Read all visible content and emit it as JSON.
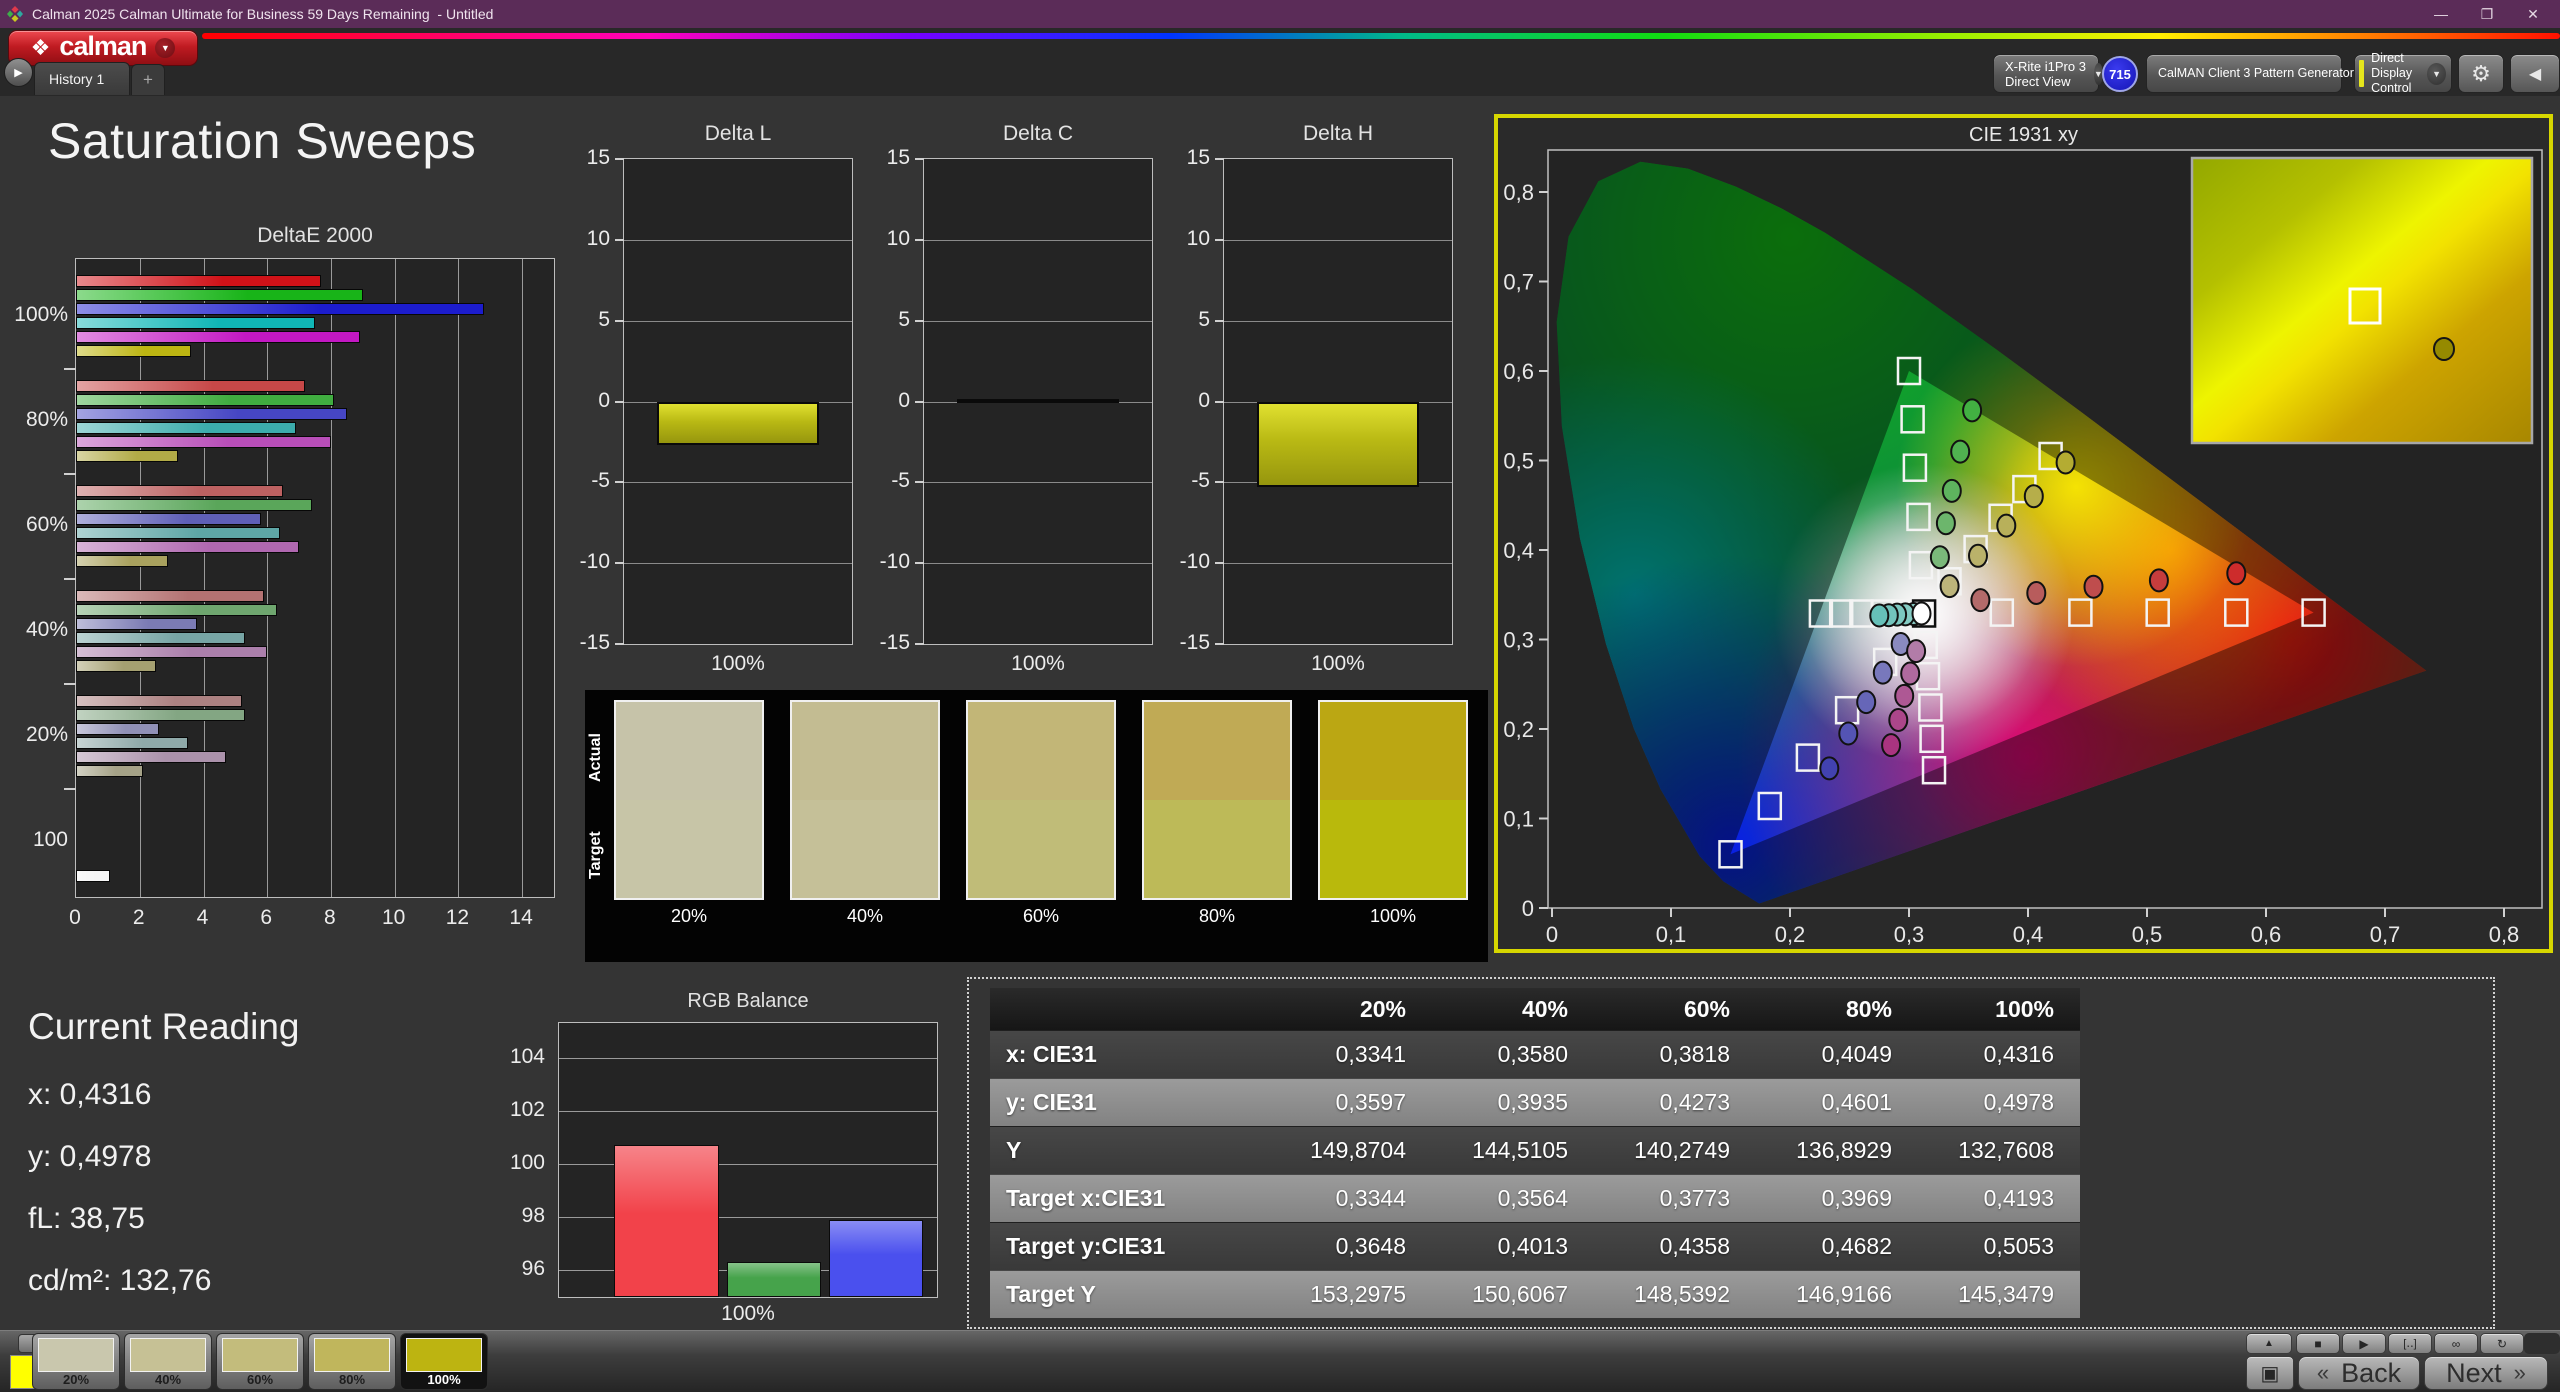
{
  "window": {
    "title": "Calman 2025 Calman Ultimate for Business 59 Days Remaining  - Untitled",
    "minimize": "—",
    "restore": "❐",
    "close": "✕"
  },
  "app": {
    "logo_label": "calman",
    "logo_glyph": "❖",
    "tab_history": "History 1",
    "tab_add": "+",
    "meter": {
      "line1": "X-Rite i1Pro 3",
      "line2": "Direct View",
      "badge": "715",
      "accent": "#3fd43f"
    },
    "source": {
      "label": "CalMAN Client 3 Pattern Generator",
      "accent": "#3fd43f"
    },
    "display_control": {
      "label": "Direct Display Control",
      "accent": "#e6e61c"
    },
    "gear_glyph": "⚙",
    "collapse_glyph": "◀",
    "expander_glyph": "▶",
    "chevron_glyph": "▼"
  },
  "page": {
    "title": "Saturation Sweeps"
  },
  "chart_data": [
    {
      "name": "deltae2000",
      "type": "bar",
      "orientation": "horizontal",
      "title": "DeltaE 2000",
      "x_ticks": [
        0,
        2,
        4,
        6,
        8,
        10,
        12,
        14
      ],
      "xlim": [
        0,
        15
      ],
      "series_order": [
        "red",
        "green",
        "blue",
        "cyan",
        "magenta",
        "yellow"
      ],
      "groups": [
        {
          "label": "100%",
          "values": [
            7.7,
            9.0,
            12.8,
            7.5,
            8.9,
            3.6
          ],
          "colors": [
            "#d01218",
            "#18b418",
            "#1c1ccd",
            "#10b6b6",
            "#c318c3",
            "#bdb512"
          ]
        },
        {
          "label": "80%",
          "values": [
            7.2,
            8.1,
            8.5,
            6.9,
            8.0,
            3.2
          ],
          "colors": [
            "#c74848",
            "#40ad40",
            "#4646c4",
            "#3cacac",
            "#b84eb8",
            "#b2ab47"
          ]
        },
        {
          "label": "60%",
          "values": [
            6.5,
            7.4,
            5.8,
            6.4,
            7.0,
            2.9
          ],
          "colors": [
            "#bd6161",
            "#5aa65a",
            "#5f5fb7",
            "#5ea6a6",
            "#b068b0",
            "#a9a15e"
          ]
        },
        {
          "label": "40%",
          "values": [
            5.9,
            6.3,
            3.8,
            5.3,
            6.0,
            2.5
          ],
          "colors": [
            "#b47272",
            "#6fa66f",
            "#7b7bb4",
            "#77a5a5",
            "#ab7fab",
            "#a5a071"
          ]
        },
        {
          "label": "20%",
          "values": [
            5.2,
            5.3,
            2.6,
            3.5,
            4.7,
            2.1
          ],
          "colors": [
            "#ac8181",
            "#83a683",
            "#9090b6",
            "#8fa9a9",
            "#ab92ab",
            "#a5a287"
          ]
        },
        {
          "label": "100",
          "values": [
            null,
            null,
            null,
            null,
            null,
            1.05
          ],
          "colors": [
            null,
            null,
            null,
            null,
            null,
            "#f5f5f5"
          ]
        }
      ]
    },
    {
      "name": "delta_l",
      "type": "bar",
      "title": "Delta L",
      "value": -2.7,
      "ylim": [
        -15,
        15
      ],
      "y_ticks": [
        15,
        10,
        5,
        0,
        -5,
        -10,
        -15
      ],
      "xlabel": "100%",
      "bar_color": "#c2c216"
    },
    {
      "name": "delta_c",
      "type": "bar",
      "title": "Delta C",
      "value": 0.15,
      "ylim": [
        -15,
        15
      ],
      "y_ticks": [
        15,
        10,
        5,
        0,
        -5,
        -10,
        -15
      ],
      "xlabel": "100%",
      "bar_color": "#c2c216"
    },
    {
      "name": "delta_h",
      "type": "bar",
      "title": "Delta H",
      "value": -5.3,
      "ylim": [
        -15,
        15
      ],
      "y_ticks": [
        15,
        10,
        5,
        0,
        -5,
        -10,
        -15
      ],
      "xlabel": "100%",
      "bar_color": "#c2c216"
    },
    {
      "name": "rgb_balance",
      "type": "bar",
      "title": "RGB Balance",
      "categories": [
        "Red",
        "Green",
        "Blue"
      ],
      "values": [
        100.7,
        96.3,
        97.9
      ],
      "colors": [
        "#f2424a",
        "#46a34b",
        "#4a50ee"
      ],
      "y_ticks": [
        96,
        98,
        100,
        102,
        104
      ],
      "ylim": [
        95,
        105.3
      ],
      "xlabel": "100%"
    },
    {
      "name": "cie1931",
      "type": "scatter",
      "title": "CIE 1931 xy",
      "x_ticks": [
        "0",
        "0,1",
        "0,2",
        "0,3",
        "0,4",
        "0,5",
        "0,6",
        "0,7",
        "0,8"
      ],
      "y_ticks": [
        "0",
        "0,1",
        "0,2",
        "0,3",
        "0,4",
        "0,5",
        "0,6",
        "0,7",
        "0,8"
      ],
      "xlim": [
        0,
        0.835
      ],
      "ylim": [
        0,
        0.847
      ],
      "gamut_triangle": [
        [
          0.64,
          0.33
        ],
        [
          0.3,
          0.6
        ],
        [
          0.15,
          0.06
        ]
      ],
      "white_point": [
        0.3127,
        0.329
      ],
      "targets": [
        [
          0.295,
          0.329
        ],
        [
          0.278,
          0.329
        ],
        [
          0.26,
          0.329
        ],
        [
          0.243,
          0.329
        ],
        [
          0.226,
          0.329
        ],
        [
          0.378,
          0.33
        ],
        [
          0.444,
          0.33
        ],
        [
          0.509,
          0.33
        ],
        [
          0.575,
          0.33
        ],
        [
          0.64,
          0.33
        ],
        [
          0.31,
          0.383
        ],
        [
          0.308,
          0.437
        ],
        [
          0.305,
          0.492
        ],
        [
          0.303,
          0.546
        ],
        [
          0.3,
          0.6
        ],
        [
          0.28,
          0.275
        ],
        [
          0.248,
          0.221
        ],
        [
          0.215,
          0.168
        ],
        [
          0.183,
          0.114
        ],
        [
          0.15,
          0.06
        ],
        [
          0.314,
          0.294
        ],
        [
          0.316,
          0.259
        ],
        [
          0.318,
          0.224
        ],
        [
          0.319,
          0.189
        ],
        [
          0.321,
          0.154
        ],
        [
          0.334,
          0.365
        ],
        [
          0.356,
          0.401
        ],
        [
          0.377,
          0.436
        ],
        [
          0.397,
          0.468
        ],
        [
          0.419,
          0.505
        ]
      ],
      "measured": [
        {
          "x": 0.304,
          "y": 0.3285,
          "c": "#8fd0c8"
        },
        {
          "x": 0.297,
          "y": 0.328,
          "c": "#85ccc4"
        },
        {
          "x": 0.29,
          "y": 0.3278,
          "c": "#7cc8c0"
        },
        {
          "x": 0.283,
          "y": 0.3272,
          "c": "#72c4bc"
        },
        {
          "x": 0.275,
          "y": 0.3268,
          "c": "#66c0b8"
        },
        {
          "x": 0.3105,
          "y": 0.329,
          "c": "#ffffff"
        },
        {
          "x": 0.36,
          "y": 0.344,
          "c": "#b36a6a"
        },
        {
          "x": 0.407,
          "y": 0.352,
          "c": "#b85c5c"
        },
        {
          "x": 0.455,
          "y": 0.359,
          "c": "#bf4d4d"
        },
        {
          "x": 0.51,
          "y": 0.366,
          "c": "#c63d3d"
        },
        {
          "x": 0.575,
          "y": 0.374,
          "c": "#cd2c2c"
        },
        {
          "x": 0.326,
          "y": 0.392,
          "c": "#7ab87a"
        },
        {
          "x": 0.331,
          "y": 0.43,
          "c": "#6cb66c"
        },
        {
          "x": 0.336,
          "y": 0.466,
          "c": "#5eb45e"
        },
        {
          "x": 0.343,
          "y": 0.51,
          "c": "#50b250"
        },
        {
          "x": 0.353,
          "y": 0.556,
          "c": "#42b042"
        },
        {
          "x": 0.293,
          "y": 0.295,
          "c": "#8a8ac0"
        },
        {
          "x": 0.278,
          "y": 0.263,
          "c": "#7878bc"
        },
        {
          "x": 0.264,
          "y": 0.23,
          "c": "#6666b8"
        },
        {
          "x": 0.249,
          "y": 0.195,
          "c": "#5454b4"
        },
        {
          "x": 0.233,
          "y": 0.156,
          "c": "#4242b0"
        },
        {
          "x": 0.306,
          "y": 0.287,
          "c": "#b27ca8"
        },
        {
          "x": 0.301,
          "y": 0.262,
          "c": "#b06a9e"
        },
        {
          "x": 0.296,
          "y": 0.237,
          "c": "#ae5894"
        },
        {
          "x": 0.291,
          "y": 0.21,
          "c": "#ac468a"
        },
        {
          "x": 0.285,
          "y": 0.182,
          "c": "#aa3480"
        },
        {
          "x": 0.3341,
          "y": 0.3597,
          "c": "#bcb47a"
        },
        {
          "x": 0.358,
          "y": 0.3935,
          "c": "#bab26a"
        },
        {
          "x": 0.3818,
          "y": 0.4273,
          "c": "#b8b05a"
        },
        {
          "x": 0.4049,
          "y": 0.4601,
          "c": "#b6ae4a"
        },
        {
          "x": 0.4316,
          "y": 0.4978,
          "c": "#b4ac32"
        }
      ],
      "inset": {
        "square": [
          0.51,
          0.52
        ],
        "circle": [
          0.74,
          0.67
        ]
      }
    }
  ],
  "swatch_panel": {
    "row_labels": [
      "Actual",
      "Target"
    ],
    "columns": [
      "20%",
      "40%",
      "60%",
      "80%",
      "100%"
    ],
    "actual_colors": [
      "#c6c3a9",
      "#c3bc92",
      "#c2b677",
      "#c0aa55",
      "#bba713"
    ],
    "target_colors": [
      "#c7c5a7",
      "#c5c098",
      "#c0bc78",
      "#bdba58",
      "#b9b90c"
    ]
  },
  "current_reading": {
    "title": "Current Reading",
    "lines": [
      "x: 0,4316",
      "y: 0,4978",
      "fL: 38,75",
      "cd/m²: 132,76"
    ]
  },
  "table": {
    "columns": [
      "20%",
      "40%",
      "60%",
      "80%",
      "100%"
    ],
    "rows": [
      {
        "label": "x: CIE31",
        "values": [
          "0,3341",
          "0,3580",
          "0,3818",
          "0,4049",
          "0,4316"
        ]
      },
      {
        "label": "y: CIE31",
        "values": [
          "0,3597",
          "0,3935",
          "0,4273",
          "0,4601",
          "0,4978"
        ]
      },
      {
        "label": "Y",
        "values": [
          "149,8704",
          "144,5105",
          "140,2749",
          "136,8929",
          "132,7608"
        ]
      },
      {
        "label": "Target x:CIE31",
        "values": [
          "0,3344",
          "0,3564",
          "0,3773",
          "0,3969",
          "0,4193"
        ]
      },
      {
        "label": "Target y:CIE31",
        "values": [
          "0,3648",
          "0,4013",
          "0,4358",
          "0,4682",
          "0,5053"
        ]
      },
      {
        "label": "Target Y",
        "values": [
          "153,2975",
          "150,6067",
          "148,5392",
          "146,9166",
          "145,3479"
        ]
      }
    ]
  },
  "bottom_bar": {
    "preview_color": "#ffff00",
    "up_glyph": "▲",
    "swatches": [
      {
        "label": "20%",
        "color": "#c9c7ad",
        "selected": false
      },
      {
        "label": "40%",
        "color": "#c6c195",
        "selected": false
      },
      {
        "label": "60%",
        "color": "#c3bc7c",
        "selected": false
      },
      {
        "label": "80%",
        "color": "#c0b65c",
        "selected": false
      },
      {
        "label": "100%",
        "color": "#bdb411",
        "selected": true
      }
    ],
    "transport_icons": [
      {
        "name": "stop",
        "glyph": "■"
      },
      {
        "name": "play",
        "glyph": "▶"
      },
      {
        "name": "pattern-window",
        "glyph": "[‥]"
      },
      {
        "name": "loop-infinite",
        "glyph": "∞"
      },
      {
        "name": "refresh",
        "glyph": "↻"
      }
    ],
    "stop_big_glyph": "▣",
    "back_chevron": "«",
    "back_label": "Back",
    "next_label": "Next",
    "next_chevron": "»"
  }
}
